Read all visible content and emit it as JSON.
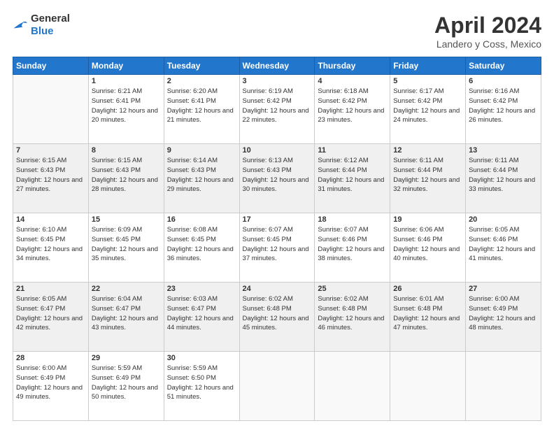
{
  "logo": {
    "general": "General",
    "blue": "Blue"
  },
  "header": {
    "month": "April 2024",
    "location": "Landero y Coss, Mexico"
  },
  "weekdays": [
    "Sunday",
    "Monday",
    "Tuesday",
    "Wednesday",
    "Thursday",
    "Friday",
    "Saturday"
  ],
  "weeks": [
    [
      {
        "day": "",
        "sunrise": "",
        "sunset": "",
        "daylight": ""
      },
      {
        "day": "1",
        "sunrise": "6:21 AM",
        "sunset": "6:41 PM",
        "daylight": "12 hours and 20 minutes."
      },
      {
        "day": "2",
        "sunrise": "6:20 AM",
        "sunset": "6:41 PM",
        "daylight": "12 hours and 21 minutes."
      },
      {
        "day": "3",
        "sunrise": "6:19 AM",
        "sunset": "6:42 PM",
        "daylight": "12 hours and 22 minutes."
      },
      {
        "day": "4",
        "sunrise": "6:18 AM",
        "sunset": "6:42 PM",
        "daylight": "12 hours and 23 minutes."
      },
      {
        "day": "5",
        "sunrise": "6:17 AM",
        "sunset": "6:42 PM",
        "daylight": "12 hours and 24 minutes."
      },
      {
        "day": "6",
        "sunrise": "6:16 AM",
        "sunset": "6:42 PM",
        "daylight": "12 hours and 26 minutes."
      }
    ],
    [
      {
        "day": "7",
        "sunrise": "6:15 AM",
        "sunset": "6:43 PM",
        "daylight": "12 hours and 27 minutes."
      },
      {
        "day": "8",
        "sunrise": "6:15 AM",
        "sunset": "6:43 PM",
        "daylight": "12 hours and 28 minutes."
      },
      {
        "day": "9",
        "sunrise": "6:14 AM",
        "sunset": "6:43 PM",
        "daylight": "12 hours and 29 minutes."
      },
      {
        "day": "10",
        "sunrise": "6:13 AM",
        "sunset": "6:43 PM",
        "daylight": "12 hours and 30 minutes."
      },
      {
        "day": "11",
        "sunrise": "6:12 AM",
        "sunset": "6:44 PM",
        "daylight": "12 hours and 31 minutes."
      },
      {
        "day": "12",
        "sunrise": "6:11 AM",
        "sunset": "6:44 PM",
        "daylight": "12 hours and 32 minutes."
      },
      {
        "day": "13",
        "sunrise": "6:11 AM",
        "sunset": "6:44 PM",
        "daylight": "12 hours and 33 minutes."
      }
    ],
    [
      {
        "day": "14",
        "sunrise": "6:10 AM",
        "sunset": "6:45 PM",
        "daylight": "12 hours and 34 minutes."
      },
      {
        "day": "15",
        "sunrise": "6:09 AM",
        "sunset": "6:45 PM",
        "daylight": "12 hours and 35 minutes."
      },
      {
        "day": "16",
        "sunrise": "6:08 AM",
        "sunset": "6:45 PM",
        "daylight": "12 hours and 36 minutes."
      },
      {
        "day": "17",
        "sunrise": "6:07 AM",
        "sunset": "6:45 PM",
        "daylight": "12 hours and 37 minutes."
      },
      {
        "day": "18",
        "sunrise": "6:07 AM",
        "sunset": "6:46 PM",
        "daylight": "12 hours and 38 minutes."
      },
      {
        "day": "19",
        "sunrise": "6:06 AM",
        "sunset": "6:46 PM",
        "daylight": "12 hours and 40 minutes."
      },
      {
        "day": "20",
        "sunrise": "6:05 AM",
        "sunset": "6:46 PM",
        "daylight": "12 hours and 41 minutes."
      }
    ],
    [
      {
        "day": "21",
        "sunrise": "6:05 AM",
        "sunset": "6:47 PM",
        "daylight": "12 hours and 42 minutes."
      },
      {
        "day": "22",
        "sunrise": "6:04 AM",
        "sunset": "6:47 PM",
        "daylight": "12 hours and 43 minutes."
      },
      {
        "day": "23",
        "sunrise": "6:03 AM",
        "sunset": "6:47 PM",
        "daylight": "12 hours and 44 minutes."
      },
      {
        "day": "24",
        "sunrise": "6:02 AM",
        "sunset": "6:48 PM",
        "daylight": "12 hours and 45 minutes."
      },
      {
        "day": "25",
        "sunrise": "6:02 AM",
        "sunset": "6:48 PM",
        "daylight": "12 hours and 46 minutes."
      },
      {
        "day": "26",
        "sunrise": "6:01 AM",
        "sunset": "6:48 PM",
        "daylight": "12 hours and 47 minutes."
      },
      {
        "day": "27",
        "sunrise": "6:00 AM",
        "sunset": "6:49 PM",
        "daylight": "12 hours and 48 minutes."
      }
    ],
    [
      {
        "day": "28",
        "sunrise": "6:00 AM",
        "sunset": "6:49 PM",
        "daylight": "12 hours and 49 minutes."
      },
      {
        "day": "29",
        "sunrise": "5:59 AM",
        "sunset": "6:49 PM",
        "daylight": "12 hours and 50 minutes."
      },
      {
        "day": "30",
        "sunrise": "5:59 AM",
        "sunset": "6:50 PM",
        "daylight": "12 hours and 51 minutes."
      },
      {
        "day": "",
        "sunrise": "",
        "sunset": "",
        "daylight": ""
      },
      {
        "day": "",
        "sunrise": "",
        "sunset": "",
        "daylight": ""
      },
      {
        "day": "",
        "sunrise": "",
        "sunset": "",
        "daylight": ""
      },
      {
        "day": "",
        "sunrise": "",
        "sunset": "",
        "daylight": ""
      }
    ]
  ],
  "labels": {
    "sunrise": "Sunrise:",
    "sunset": "Sunset:",
    "daylight": "Daylight:"
  }
}
